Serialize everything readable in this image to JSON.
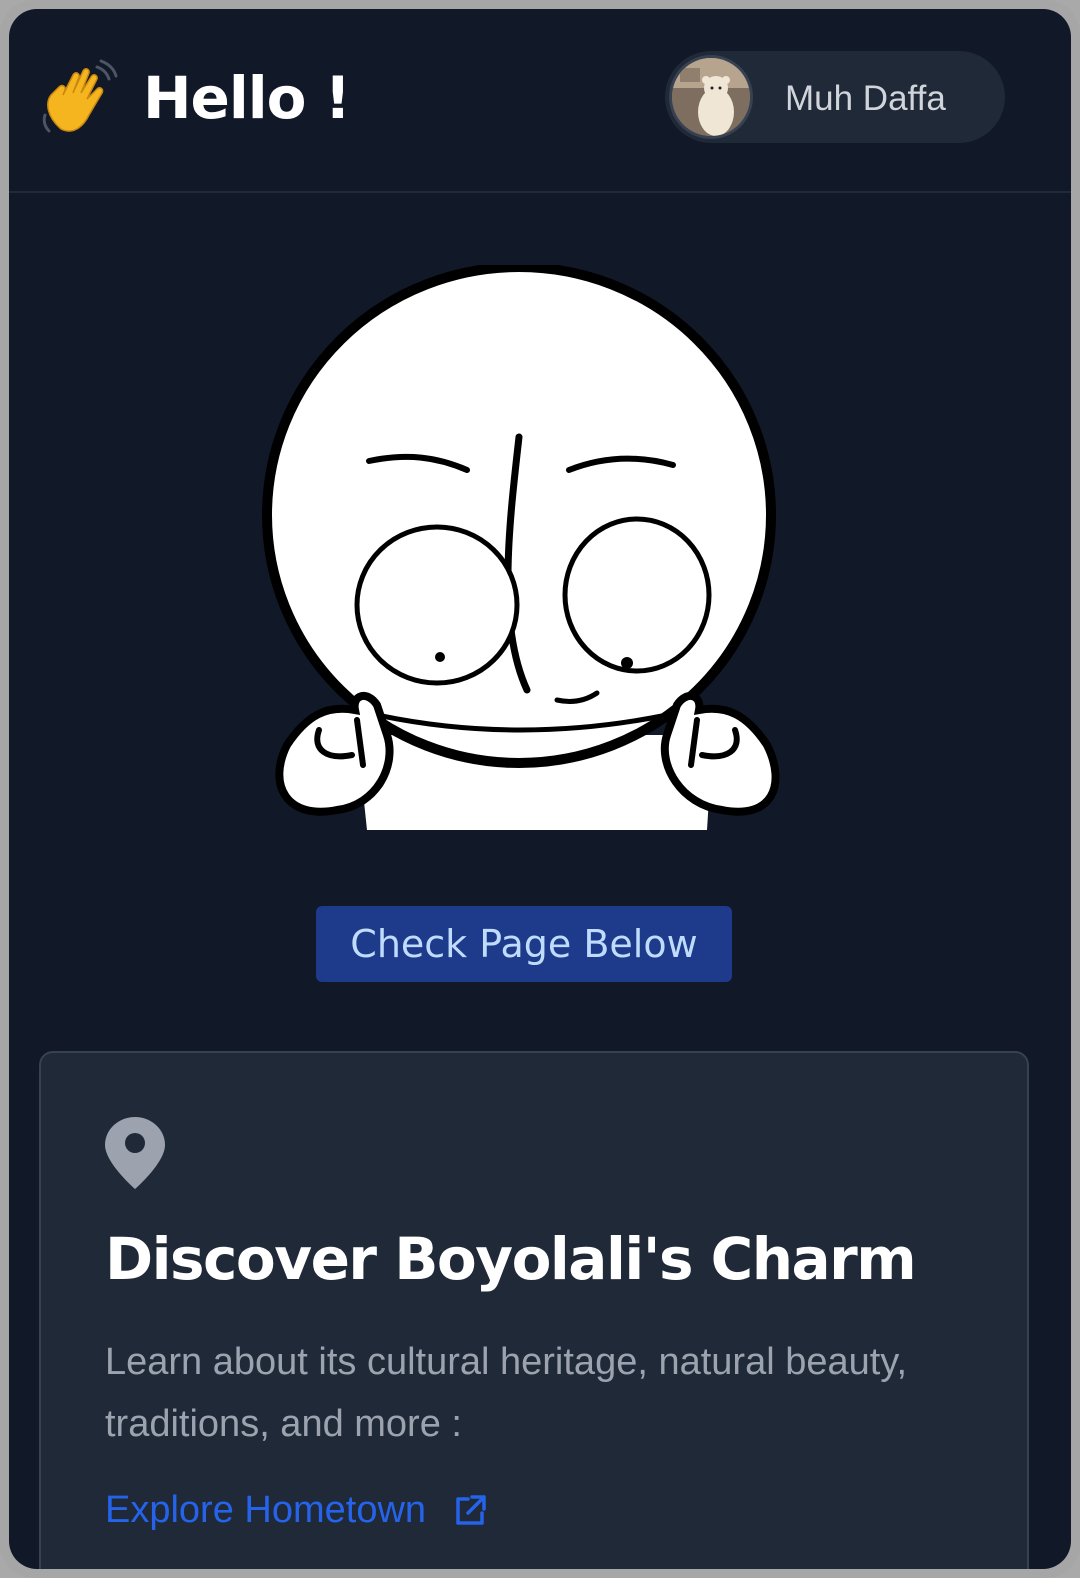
{
  "header": {
    "greeting": "Hello !",
    "user_name": "Muh Daffa",
    "wave_icon": "waving-hand-icon"
  },
  "hero": {
    "cta_label": "Check Page Below"
  },
  "card": {
    "icon": "map-pin-icon",
    "title": "Discover Boyolali's Charm",
    "description": "Learn about its cultural heritage, natural beauty, traditions, and more :",
    "link_label": "Explore Hometown",
    "link_icon": "external-link-icon"
  },
  "colors": {
    "background": "#111827",
    "card": "#1f2937",
    "button": "#1e3a8a",
    "button_text": "#bfdbfe",
    "link": "#2563eb",
    "muted_text": "#9ca3af"
  }
}
